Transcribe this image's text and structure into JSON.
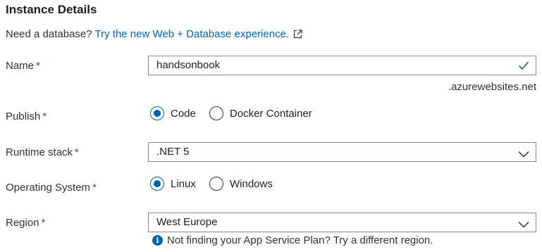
{
  "section": {
    "title": "Instance Details"
  },
  "database_prompt": {
    "text": "Need a database?",
    "link": "Try the new Web + Database experience.",
    "link_icon": "external-link-icon"
  },
  "name_field": {
    "label": "Name",
    "required": "*",
    "value": "handsonbook",
    "valid_icon": "checkmark-icon",
    "suffix": ".azurewebsites.net"
  },
  "publish": {
    "label": "Publish",
    "required": "*",
    "options": [
      "Code",
      "Docker Container"
    ],
    "selected": "Code"
  },
  "runtime_stack": {
    "label": "Runtime stack",
    "required": "*",
    "value": ".NET 5",
    "icon": "chevron-down-icon"
  },
  "operating_system": {
    "label": "Operating System",
    "required": "*",
    "options": [
      "Linux",
      "Windows"
    ],
    "selected": "Linux"
  },
  "region": {
    "label": "Region",
    "required": "*",
    "value": "West Europe",
    "icon": "chevron-down-icon",
    "info": "Not finding your App Service Plan? Try a different region."
  },
  "colors": {
    "link": "#0062ad",
    "required": "#a4262c",
    "valid": "#107c10",
    "border": "#8a8886"
  }
}
